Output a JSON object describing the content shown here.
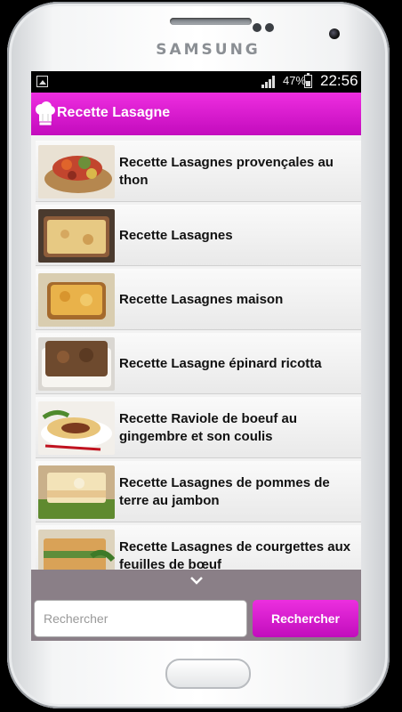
{
  "device": {
    "brand": "SAMSUNG"
  },
  "statusbar": {
    "battery": "47%",
    "time": "22:56",
    "icons": [
      "image-icon",
      "signal-icon",
      "battery-icon"
    ]
  },
  "appbar": {
    "title": "Recette Lasagne",
    "icon": "chef-hat-icon",
    "color": "#d91ad2"
  },
  "recipes": [
    {
      "label": "Recette Lasagnes provençales au thon"
    },
    {
      "label": "Recette Lasagnes"
    },
    {
      "label": "Recette Lasagnes maison"
    },
    {
      "label": "Recette Lasagne épinard ricotta"
    },
    {
      "label": "Recette Raviole de boeuf au gingembre et son coulis"
    },
    {
      "label": "Recette Lasagnes de pommes de terre au jambon"
    },
    {
      "label": "Recette Lasagnes de courgettes aux feuilles de bœuf"
    }
  ],
  "search": {
    "placeholder": "Rechercher",
    "value": "",
    "button_label": "Rechercher",
    "toggle_icon": "chevron-down-icon"
  }
}
